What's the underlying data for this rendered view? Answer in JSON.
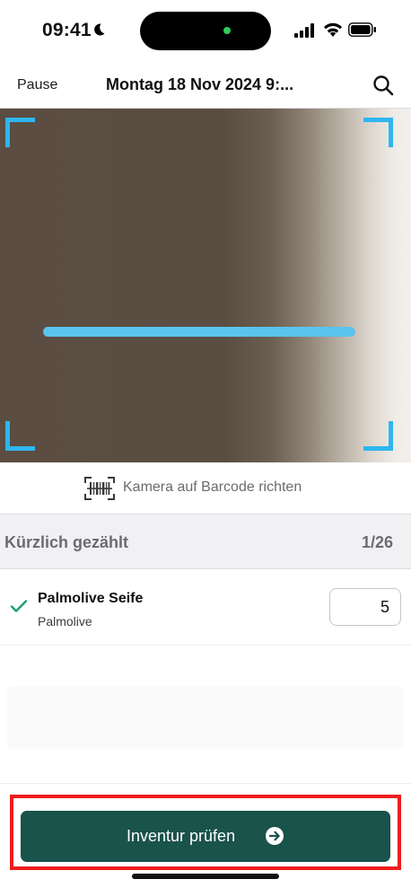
{
  "status_bar": {
    "time": "09:41",
    "icons": [
      "moon-icon",
      "cellular-signal-icon",
      "wifi-icon",
      "battery-icon"
    ]
  },
  "nav": {
    "pause_label": "Pause",
    "title": "Montag 18 Nov 2024 9:...",
    "search_icon": "search-icon"
  },
  "scanner": {
    "hint_icon": "barcode-scan-icon",
    "hint_text": "Kamera auf Barcode richten",
    "accent_color": "#2fb6ef"
  },
  "recent": {
    "title": "Kürzlich gezählt",
    "count": "1/26"
  },
  "items": [
    {
      "name": "Palmolive Seife",
      "brand": "Palmolive",
      "quantity": "5",
      "status_icon": "checkmark-icon"
    }
  ],
  "footer": {
    "primary_label": "Inventur prüfen",
    "primary_icon": "arrow-right-circle-icon",
    "primary_color": "#1a524c",
    "highlight_color": "#ee1d1d"
  }
}
